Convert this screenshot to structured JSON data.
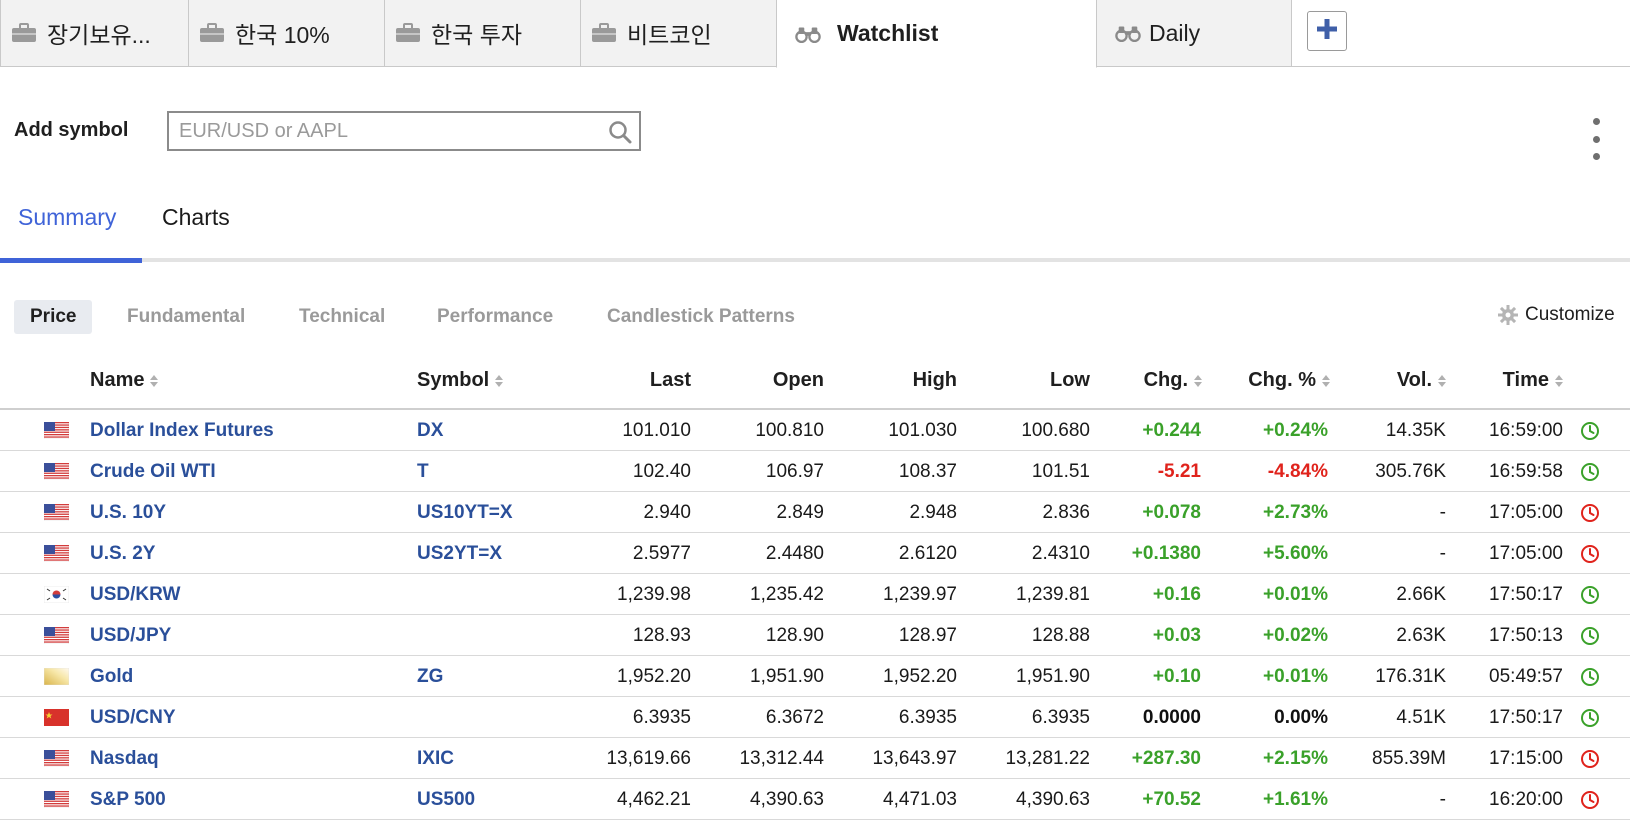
{
  "tabs": [
    {
      "label": "장기보유...",
      "icon": "briefcase-icon"
    },
    {
      "label": "한국 10%",
      "icon": "briefcase-icon"
    },
    {
      "label": "한국 투자",
      "icon": "briefcase-icon"
    },
    {
      "label": "비트코인",
      "icon": "briefcase-icon"
    },
    {
      "label": "Watchlist",
      "icon": "binoculars-icon",
      "active": true
    },
    {
      "label": "Daily",
      "icon": "binoculars-icon"
    }
  ],
  "add_tab_icon": "plus-icon",
  "add_symbol": {
    "label": "Add symbol",
    "placeholder": "EUR/USD or AAPL",
    "value": ""
  },
  "subtabs": {
    "summary": "Summary",
    "charts": "Charts"
  },
  "filters": [
    "Price",
    "Fundamental",
    "Technical",
    "Performance",
    "Candlestick Patterns"
  ],
  "customize_label": "Customize",
  "columns": {
    "name": "Name",
    "symbol": "Symbol",
    "last": "Last",
    "open": "Open",
    "high": "High",
    "low": "Low",
    "chg": "Chg.",
    "chg_pct": "Chg. %",
    "vol": "Vol.",
    "time": "Time"
  },
  "colors": {
    "positive": "#3aa12a",
    "negative": "#e0231c",
    "link": "#2a4f9a",
    "accent": "#3f63d8",
    "clock_open": "#3aa12a",
    "clock_closed": "#e0231c"
  },
  "rows": [
    {
      "flag": "us",
      "name": "Dollar Index Futures",
      "symbol": "DX",
      "last": "101.010",
      "open": "100.810",
      "high": "101.030",
      "low": "100.680",
      "chg": "+0.244",
      "chg_pct": "+0.24%",
      "dir": "pos",
      "vol": "14.35K",
      "time": "16:59:00",
      "status": "open"
    },
    {
      "flag": "us",
      "name": "Crude Oil WTI",
      "symbol": "T",
      "last": "102.40",
      "open": "106.97",
      "high": "108.37",
      "low": "101.51",
      "chg": "-5.21",
      "chg_pct": "-4.84%",
      "dir": "neg",
      "vol": "305.76K",
      "time": "16:59:58",
      "status": "open"
    },
    {
      "flag": "us",
      "name": "U.S. 10Y",
      "symbol": "US10YT=X",
      "last": "2.940",
      "open": "2.849",
      "high": "2.948",
      "low": "2.836",
      "chg": "+0.078",
      "chg_pct": "+2.73%",
      "dir": "pos",
      "vol": "-",
      "time": "17:05:00",
      "status": "closed"
    },
    {
      "flag": "us",
      "name": "U.S. 2Y",
      "symbol": "US2YT=X",
      "last": "2.5977",
      "open": "2.4480",
      "high": "2.6120",
      "low": "2.4310",
      "chg": "+0.1380",
      "chg_pct": "+5.60%",
      "dir": "pos",
      "vol": "-",
      "time": "17:05:00",
      "status": "closed"
    },
    {
      "flag": "kr",
      "name": "USD/KRW",
      "symbol": "",
      "last": "1,239.98",
      "open": "1,235.42",
      "high": "1,239.97",
      "low": "1,239.81",
      "chg": "+0.16",
      "chg_pct": "+0.01%",
      "dir": "pos",
      "vol": "2.66K",
      "time": "17:50:17",
      "status": "open"
    },
    {
      "flag": "us",
      "name": "USD/JPY",
      "symbol": "",
      "last": "128.93",
      "open": "128.90",
      "high": "128.97",
      "low": "128.88",
      "chg": "+0.03",
      "chg_pct": "+0.02%",
      "dir": "pos",
      "vol": "2.63K",
      "time": "17:50:13",
      "status": "open"
    },
    {
      "flag": "gold",
      "name": "Gold",
      "symbol": "ZG",
      "last": "1,952.20",
      "open": "1,951.90",
      "high": "1,952.20",
      "low": "1,951.90",
      "chg": "+0.10",
      "chg_pct": "+0.01%",
      "dir": "pos",
      "vol": "176.31K",
      "time": "05:49:57",
      "status": "open"
    },
    {
      "flag": "cn",
      "name": "USD/CNY",
      "symbol": "",
      "last": "6.3935",
      "open": "6.3672",
      "high": "6.3935",
      "low": "6.3935",
      "chg": "0.0000",
      "chg_pct": "0.00%",
      "dir": "neu",
      "vol": "4.51K",
      "time": "17:50:17",
      "status": "open"
    },
    {
      "flag": "us",
      "name": "Nasdaq",
      "symbol": "IXIC",
      "last": "13,619.66",
      "open": "13,312.44",
      "high": "13,643.97",
      "low": "13,281.22",
      "chg": "+287.30",
      "chg_pct": "+2.15%",
      "dir": "pos",
      "vol": "855.39M",
      "time": "17:15:00",
      "status": "closed"
    },
    {
      "flag": "us",
      "name": "S&P 500",
      "symbol": "US500",
      "last": "4,462.21",
      "open": "4,390.63",
      "high": "4,471.03",
      "low": "4,390.63",
      "chg": "+70.52",
      "chg_pct": "+1.61%",
      "dir": "pos",
      "vol": "-",
      "time": "16:20:00",
      "status": "closed"
    }
  ]
}
